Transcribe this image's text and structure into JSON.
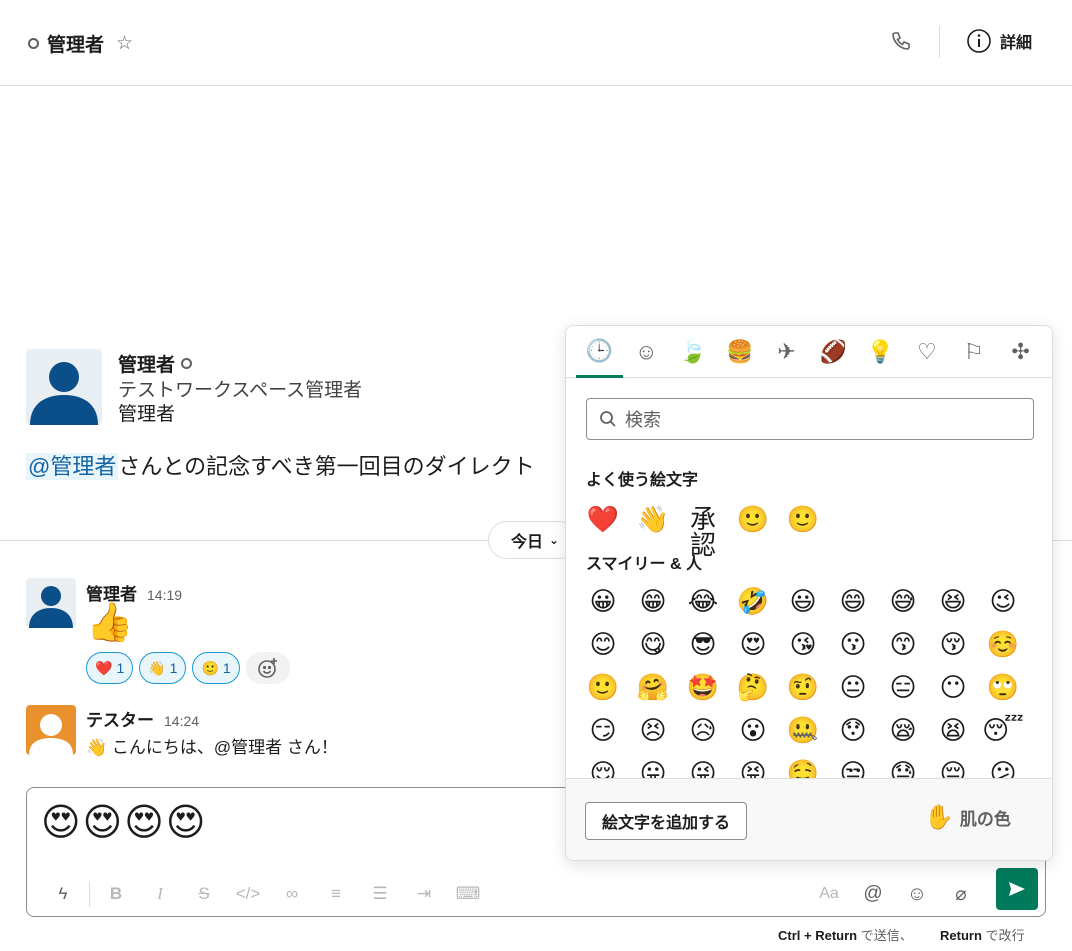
{
  "header": {
    "title": "管理者",
    "details_label": "詳細"
  },
  "intro": {
    "name": "管理者",
    "workspace_role": "テストワークスペース管理者",
    "display_name": "管理者",
    "mention": "@管理者",
    "text": "さんとの記念すべき第一回目のダイレクト"
  },
  "date_divider": {
    "label": "今日"
  },
  "messages": [
    {
      "author": "管理者",
      "time": "14:19",
      "body": "👍",
      "reactions": [
        {
          "emoji": "❤️",
          "count": "1"
        },
        {
          "emoji": "👋",
          "count": "1"
        },
        {
          "emoji": "🙂",
          "count": "1"
        }
      ]
    },
    {
      "author": "テスター",
      "time": "14:24",
      "body": "👋 こんにちは、@管理者 さん！"
    }
  ],
  "composer": {
    "text": "😍😍😍😍",
    "format_aa": "Aa",
    "hint": {
      "send_key": "Ctrl + Return",
      "send_label": "で送信、",
      "newline_key": "Return",
      "newline_label": "で改行"
    }
  },
  "emoji_picker": {
    "category_tabs": [
      {
        "name": "recent",
        "glyph": "🕒"
      },
      {
        "name": "smileys",
        "glyph": "☺"
      },
      {
        "name": "nature",
        "glyph": "🍃"
      },
      {
        "name": "food",
        "glyph": "🍔"
      },
      {
        "name": "travel",
        "glyph": "✈"
      },
      {
        "name": "activity",
        "glyph": "🏈"
      },
      {
        "name": "objects",
        "glyph": "💡"
      },
      {
        "name": "symbols",
        "glyph": "♡"
      },
      {
        "name": "flags",
        "glyph": "⚐"
      },
      {
        "name": "slack",
        "glyph": "✣"
      }
    ],
    "search_placeholder": "検索",
    "frequent_title": "よく使う絵文字",
    "frequent": [
      "❤️",
      "👋",
      "承認",
      "🙂",
      "🙂"
    ],
    "smileys_title": "スマイリー & 人",
    "smileys": [
      [
        "😀",
        "😁",
        "😂",
        "🤣",
        "😃",
        "😄",
        "😅",
        "😆",
        "😉"
      ],
      [
        "😊",
        "😋",
        "😎",
        "😍",
        "😘",
        "😗",
        "😙",
        "😚",
        "☺️"
      ],
      [
        "🙂",
        "🤗",
        "🤩",
        "🤔",
        "🤨",
        "😐",
        "😑",
        "😶",
        "🙄"
      ],
      [
        "😏",
        "😣",
        "😥",
        "😮",
        "🤐",
        "😯",
        "😪",
        "😫",
        "😴"
      ],
      [
        "😌",
        "😛",
        "😜",
        "😝",
        "🤤",
        "😒",
        "😓",
        "😔",
        "😕"
      ]
    ],
    "add_emoji_label": "絵文字を追加する",
    "skin_tone_label": "肌の色",
    "skin_tone_emoji": "✋"
  },
  "colors": {
    "accent_green": "#007a5a",
    "mention_blue": "#1264a3",
    "reaction_border": "#1d9bd1",
    "avatar_admin": "#0b4f8a",
    "avatar_tester": "#e8912d"
  }
}
